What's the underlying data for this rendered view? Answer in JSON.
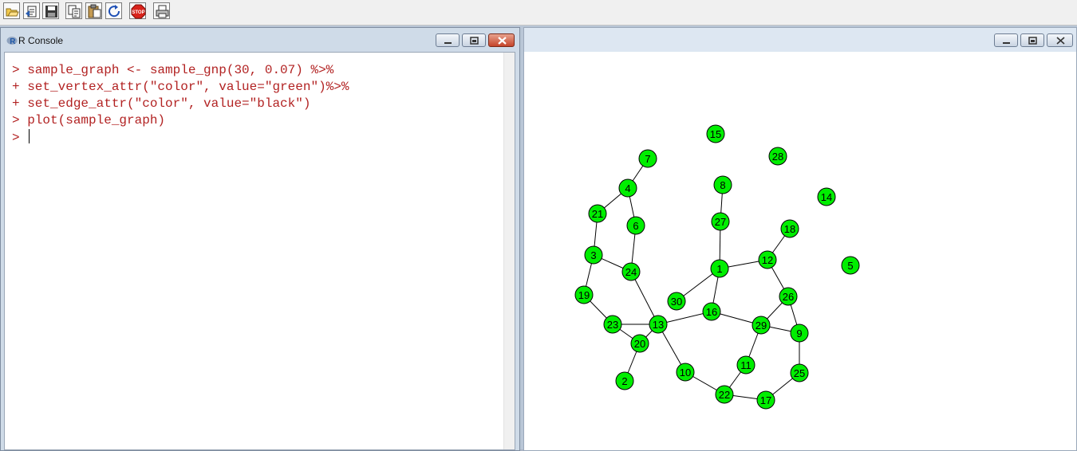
{
  "toolbar": {
    "buttons": [
      {
        "name": "open-script-icon"
      },
      {
        "name": "load-workspace-icon"
      },
      {
        "name": "save-icon"
      },
      {
        "name": "copy-icon"
      },
      {
        "name": "paste-icon"
      },
      {
        "name": "refresh-icon"
      },
      {
        "name": "stop-icon",
        "label": "STOP"
      },
      {
        "name": "print-icon"
      }
    ]
  },
  "console": {
    "title": "R Console",
    "lines": [
      "> sample_graph <- sample_gnp(30, 0.07) %>%",
      "+ set_vertex_attr(\"color\", value=\"green\")%>%",
      "+ set_edge_attr(\"color\", value=\"black\")",
      "> plot(sample_graph)"
    ],
    "prompt": "> ",
    "text_color": "#b22222"
  },
  "graphics": {
    "title": ""
  },
  "chart_data": {
    "type": "network",
    "vertex_color": "#00ee00",
    "edge_color": "#000000",
    "vertices": [
      "1",
      "2",
      "3",
      "4",
      "5",
      "6",
      "7",
      "8",
      "9",
      "10",
      "11",
      "12",
      "13",
      "14",
      "15",
      "16",
      "17",
      "18",
      "19",
      "20",
      "21",
      "22",
      "23",
      "24",
      "25",
      "26",
      "27",
      "28",
      "29",
      "30"
    ],
    "edges": [
      [
        "7",
        "4"
      ],
      [
        "4",
        "21"
      ],
      [
        "4",
        "6"
      ],
      [
        "21",
        "3"
      ],
      [
        "6",
        "24"
      ],
      [
        "3",
        "24"
      ],
      [
        "3",
        "19"
      ],
      [
        "19",
        "23"
      ],
      [
        "23",
        "13"
      ],
      [
        "23",
        "20"
      ],
      [
        "20",
        "13"
      ],
      [
        "20",
        "2"
      ],
      [
        "24",
        "13"
      ],
      [
        "13",
        "10"
      ],
      [
        "13",
        "16"
      ],
      [
        "8",
        "27"
      ],
      [
        "27",
        "1"
      ],
      [
        "1",
        "30"
      ],
      [
        "1",
        "16"
      ],
      [
        "1",
        "12"
      ],
      [
        "12",
        "18"
      ],
      [
        "12",
        "26"
      ],
      [
        "26",
        "29"
      ],
      [
        "26",
        "9"
      ],
      [
        "16",
        "29"
      ],
      [
        "29",
        "9"
      ],
      [
        "29",
        "11"
      ],
      [
        "9",
        "25"
      ],
      [
        "25",
        "17"
      ],
      [
        "17",
        "22"
      ],
      [
        "22",
        "10"
      ],
      [
        "22",
        "11"
      ]
    ]
  }
}
